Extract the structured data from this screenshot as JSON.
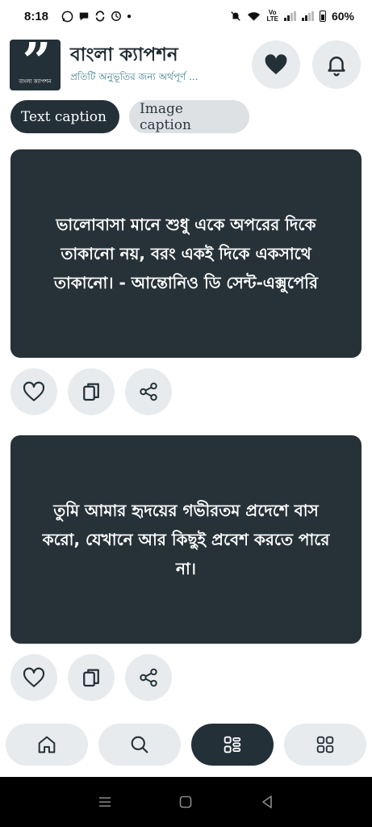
{
  "status_bar": {
    "time": "8:18",
    "battery": "60%",
    "volte_top": "Vo",
    "volte_bottom": "LTE"
  },
  "header": {
    "logo_text": "বাংলা ক্যাপশন",
    "app_title": "বাংলা ক্যাপশন",
    "app_subtitle": "প্রতিটি অনুভূতির জন্য অর্থপূর্ণ ...",
    "favorites_icon": "heart-filled-icon",
    "notification_icon": "bell-icon"
  },
  "tabs": [
    {
      "label": "Text caption",
      "active": true
    },
    {
      "label": "Image caption",
      "active": false
    }
  ],
  "captions": [
    {
      "text": "ভালোবাসা মানে শুধু একে অপরের দিকে তাকানো নয়, বরং একই দিকে একসাথে তাকানো। - আন্তোনিও ডি সেন্ট-এক্সুপেরি"
    },
    {
      "text": "তুমি আমার হৃদয়ের গভীরতম প্রদেশে বাস করো, যেখানে আর কিছুই প্রবেশ করতে পারে না।"
    }
  ],
  "caption_actions": [
    "heart-outline-icon",
    "copy-icon",
    "share-icon"
  ],
  "bottom_nav": [
    {
      "icon": "home-icon",
      "active": false
    },
    {
      "icon": "search-icon",
      "active": false
    },
    {
      "icon": "categories-icon",
      "active": true
    },
    {
      "icon": "grid-icon",
      "active": false
    }
  ],
  "colors": {
    "dark": "#263238",
    "light_button": "#e8ebed",
    "subtitle": "#3f7f8f"
  }
}
